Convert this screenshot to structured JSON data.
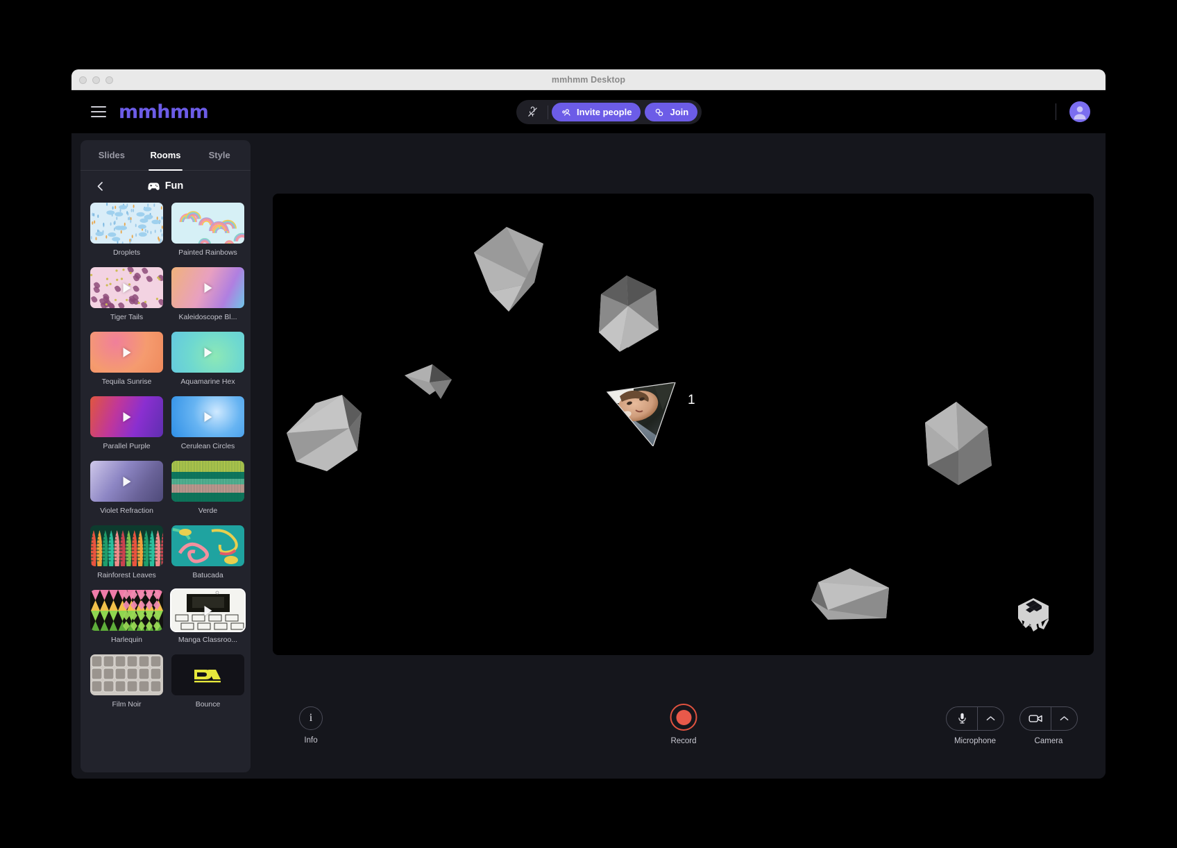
{
  "window": {
    "title": "mmhmm Desktop"
  },
  "header": {
    "brand": "mmhmm",
    "menu_icon": "hamburger-icon",
    "mute_icon": "mic-muted-icon",
    "invite_label": "Invite people",
    "join_label": "Join",
    "avatar_icon": "user-avatar-icon",
    "accent_color": "#6c5ce7"
  },
  "sidebar": {
    "tabs": [
      {
        "label": "Slides",
        "active": false
      },
      {
        "label": "Rooms",
        "active": true
      },
      {
        "label": "Style",
        "active": false
      }
    ],
    "back_icon": "chevron-left-icon",
    "category_icon": "gamepad-icon",
    "category_title": "Fun",
    "rooms": [
      {
        "label": "Droplets",
        "kind": "image",
        "has_play": false,
        "selected": false,
        "style": "droplets"
      },
      {
        "label": "Painted Rainbows",
        "kind": "image",
        "has_play": false,
        "selected": false,
        "style": "rainbows"
      },
      {
        "label": "Tiger Tails",
        "kind": "video",
        "has_play": true,
        "selected": false,
        "style": "tigertails"
      },
      {
        "label": "Kaleidoscope Bl...",
        "kind": "video",
        "has_play": true,
        "selected": false,
        "style": "kaleidoscope"
      },
      {
        "label": "Tequila Sunrise",
        "kind": "video",
        "has_play": true,
        "selected": false,
        "style": "tequila"
      },
      {
        "label": "Aquamarine Hex",
        "kind": "video",
        "has_play": true,
        "selected": false,
        "style": "aquamarine"
      },
      {
        "label": "Parallel Purple",
        "kind": "video",
        "has_play": true,
        "selected": false,
        "style": "parallel"
      },
      {
        "label": "Cerulean Circles",
        "kind": "video",
        "has_play": true,
        "selected": false,
        "style": "cerulean"
      },
      {
        "label": "Violet Refraction",
        "kind": "video",
        "has_play": true,
        "selected": false,
        "style": "violet"
      },
      {
        "label": "Verde",
        "kind": "image",
        "has_play": false,
        "selected": false,
        "style": "verde"
      },
      {
        "label": "Rainforest Leaves",
        "kind": "image",
        "has_play": false,
        "selected": false,
        "style": "rainforest"
      },
      {
        "label": "Batucada",
        "kind": "image",
        "has_play": false,
        "selected": false,
        "style": "batucada"
      },
      {
        "label": "Harlequin",
        "kind": "image",
        "has_play": false,
        "selected": false,
        "style": "harlequin"
      },
      {
        "label": "Manga Classroo...",
        "kind": "video",
        "has_play": true,
        "selected": true,
        "style": "manga"
      },
      {
        "label": "Film Noir",
        "kind": "image",
        "has_play": false,
        "selected": false,
        "style": "filmnoir"
      },
      {
        "label": "Bounce",
        "kind": "image",
        "has_play": false,
        "selected": false,
        "style": "bounce"
      }
    ]
  },
  "stage": {
    "presenter_number": "1",
    "dice_icon": "dice-cube-icon"
  },
  "controls": {
    "info_label": "Info",
    "info_icon": "info-icon",
    "record_label": "Record",
    "record_icon": "record-dot-icon",
    "record_color": "#e8594a",
    "microphone_label": "Microphone",
    "microphone_icon": "microphone-icon",
    "microphone_caret_icon": "chevron-up-icon",
    "camera_label": "Camera",
    "camera_icon": "video-camera-icon",
    "camera_caret_icon": "chevron-up-icon"
  }
}
